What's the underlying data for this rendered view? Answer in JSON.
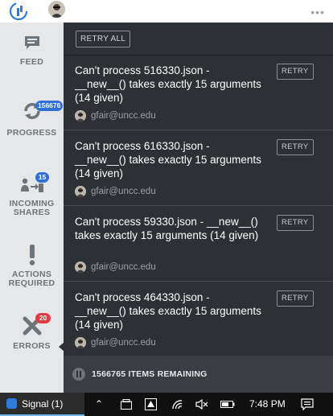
{
  "sidebar": {
    "feed": {
      "label": "FEED",
      "icon": "feed-icon"
    },
    "progress": {
      "label": "PROGRESS",
      "icon": "sync-icon",
      "badge": "156676"
    },
    "incoming": {
      "label_line1": "INCOMING",
      "label_line2": "SHARES",
      "icon": "incoming-shares-icon",
      "badge": "15"
    },
    "actions": {
      "label_line1": "ACTIONS",
      "label_line2": "REQUIRED",
      "icon": "exclamation-icon"
    },
    "errors": {
      "label": "ERRORS",
      "icon": "x-icon",
      "badge": "20"
    }
  },
  "main": {
    "retry_all_label": "RETRY ALL",
    "errors": [
      {
        "message": "Can't process 516330.json - __new__() takes exactly 15 arguments (14 given)",
        "retry_label": "RETRY",
        "user": "gfair@uncc.edu"
      },
      {
        "message": "Can't process 616330.json - __new__() takes exactly 15 arguments (14 given)",
        "retry_label": "RETRY",
        "user": "gfair@uncc.edu"
      },
      {
        "message": "Can't process 59330.json - __new__() takes exactly 15 arguments (14 given)",
        "retry_label": "RETRY",
        "user": "gfair@uncc.edu"
      },
      {
        "message": "Can't process 464330.json - __new__() takes exactly 15 arguments (14 given)",
        "retry_label": "RETRY",
        "user": "gfair@uncc.edu"
      }
    ],
    "footer": {
      "remaining": "1566765 ITEMS REMAINING"
    }
  },
  "taskbar": {
    "signal_label": "Signal (1)",
    "time": "7:48 PM"
  },
  "colors": {
    "panel": "#2d3034",
    "sidebar": "#e6e7e8",
    "badge_blue": "#2f6fd6",
    "badge_red": "#e53a45",
    "accent": "#2e7cd8"
  }
}
